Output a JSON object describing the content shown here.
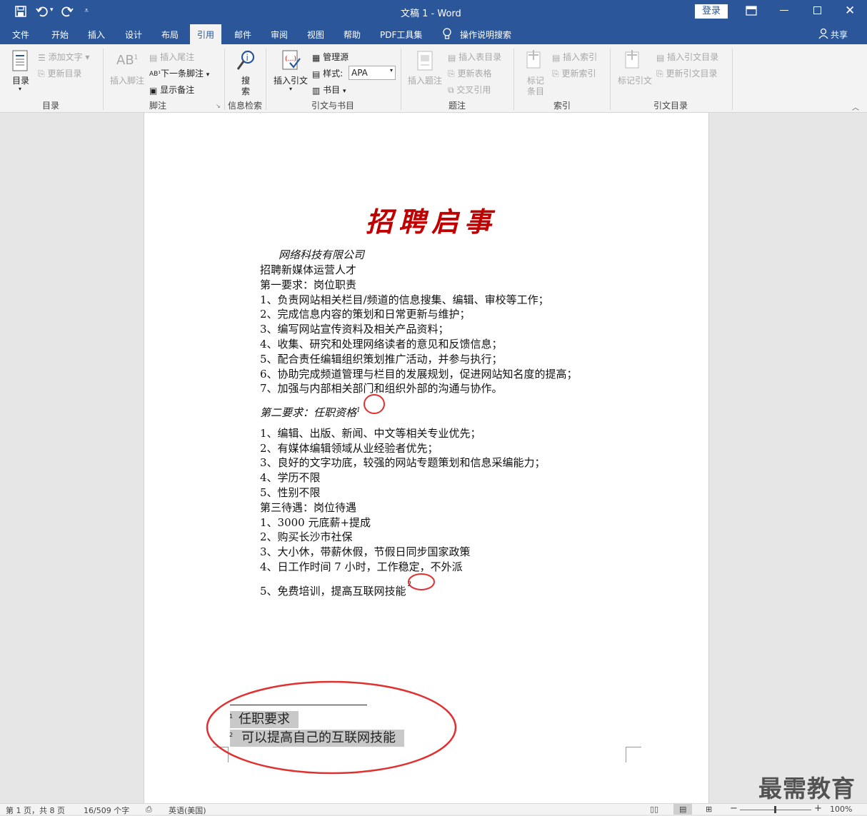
{
  "titlebar": {
    "doc_title": "文稿 1  -  Word",
    "login_label": "登录"
  },
  "tabs": [
    "文件",
    "开始",
    "插入",
    "设计",
    "布局",
    "引用",
    "邮件",
    "审阅",
    "视图",
    "帮助",
    "PDF工具集"
  ],
  "tellme": "操作说明搜索",
  "share": "共享",
  "ribbon": {
    "toc": {
      "big": "目录",
      "add_text": "添加文字",
      "update_toc": "更新目录",
      "group": "目录"
    },
    "footnote": {
      "insert_footnote": "插入脚注",
      "insert_endnote": "插入尾注",
      "next_footnote": "下一条脚注",
      "show_notes": "显示备注",
      "group": "脚注"
    },
    "research": {
      "big": "搜\n索",
      "big_1": "搜",
      "big_2": "索",
      "group": "信息检索"
    },
    "citation": {
      "insert_citation": "插入引文",
      "manage_sources": "管理源",
      "style_label": "样式:",
      "style_value": "APA",
      "bibliography": "书目",
      "group": "引文与书目"
    },
    "caption": {
      "insert_caption": "插入题注",
      "insert_table_figures": "插入表目录",
      "update_table": "更新表格",
      "cross_ref": "交叉引用",
      "group": "题注"
    },
    "index": {
      "mark_entry_1": "标记",
      "mark_entry_2": "条目",
      "insert_index": "插入索引",
      "update_index": "更新索引",
      "group": "索引"
    },
    "toa": {
      "mark_citation": "标记引文",
      "insert_toa": "插入引文目录",
      "update_toa": "更新引文目录",
      "group": "引文目录"
    }
  },
  "document": {
    "title": "招聘启事",
    "lines": [
      "网络科技有限公司",
      "招聘新媒体运营人才",
      "第一要求：岗位职责",
      "1、负责网站相关栏目/频道的信息搜集、编辑、审校等工作；",
      "2、完成信息内容的策划和日常更新与维护；",
      "3、编写网站宣传资料及相关产品资料；",
      "4、收集、研究和处理网络读者的意见和反馈信息；",
      "5、配合责任编辑组织策划推广活动，并参与执行；",
      "6、协助完成频道管理与栏目的发展规划，促进网站知名度的提高；",
      "7、加强与内部相关部门和组织外部的沟通与协作。",
      "第二要求：任职资格",
      "1、编辑、出版、新闻、中文等相关专业优先；",
      "2、有媒体编辑领域从业经验者优先；",
      "3、良好的文字功底，较强的网站专题策划和信息采编能力；",
      "4、学历不限",
      "5、性别不限",
      "第三待遇：岗位待遇",
      "1、3000 元底薪+提成",
      "2、购买长沙市社保",
      "3、大小休，带薪休假，节假日同步国家政策",
      "4、日工作时间 7 小时，工作稳定，不外派",
      "5、免费培训，提高互联网技能"
    ],
    "footnote_marks": [
      "1",
      "2"
    ],
    "footnotes": [
      {
        "num": "1",
        "text": "任职要求"
      },
      {
        "num": "2",
        "text": "可以提高自己的互联网技能"
      }
    ]
  },
  "watermark": "最需教育",
  "status": {
    "page": "第 1 页，共 8 页",
    "words": "16/509 个字",
    "lang": "英语(美国)",
    "zoom": "100%",
    "minus": "−",
    "plus": "+"
  },
  "colors": {
    "brand": "#2b579a",
    "title_red": "#c00000",
    "annot_red": "#e03030"
  }
}
